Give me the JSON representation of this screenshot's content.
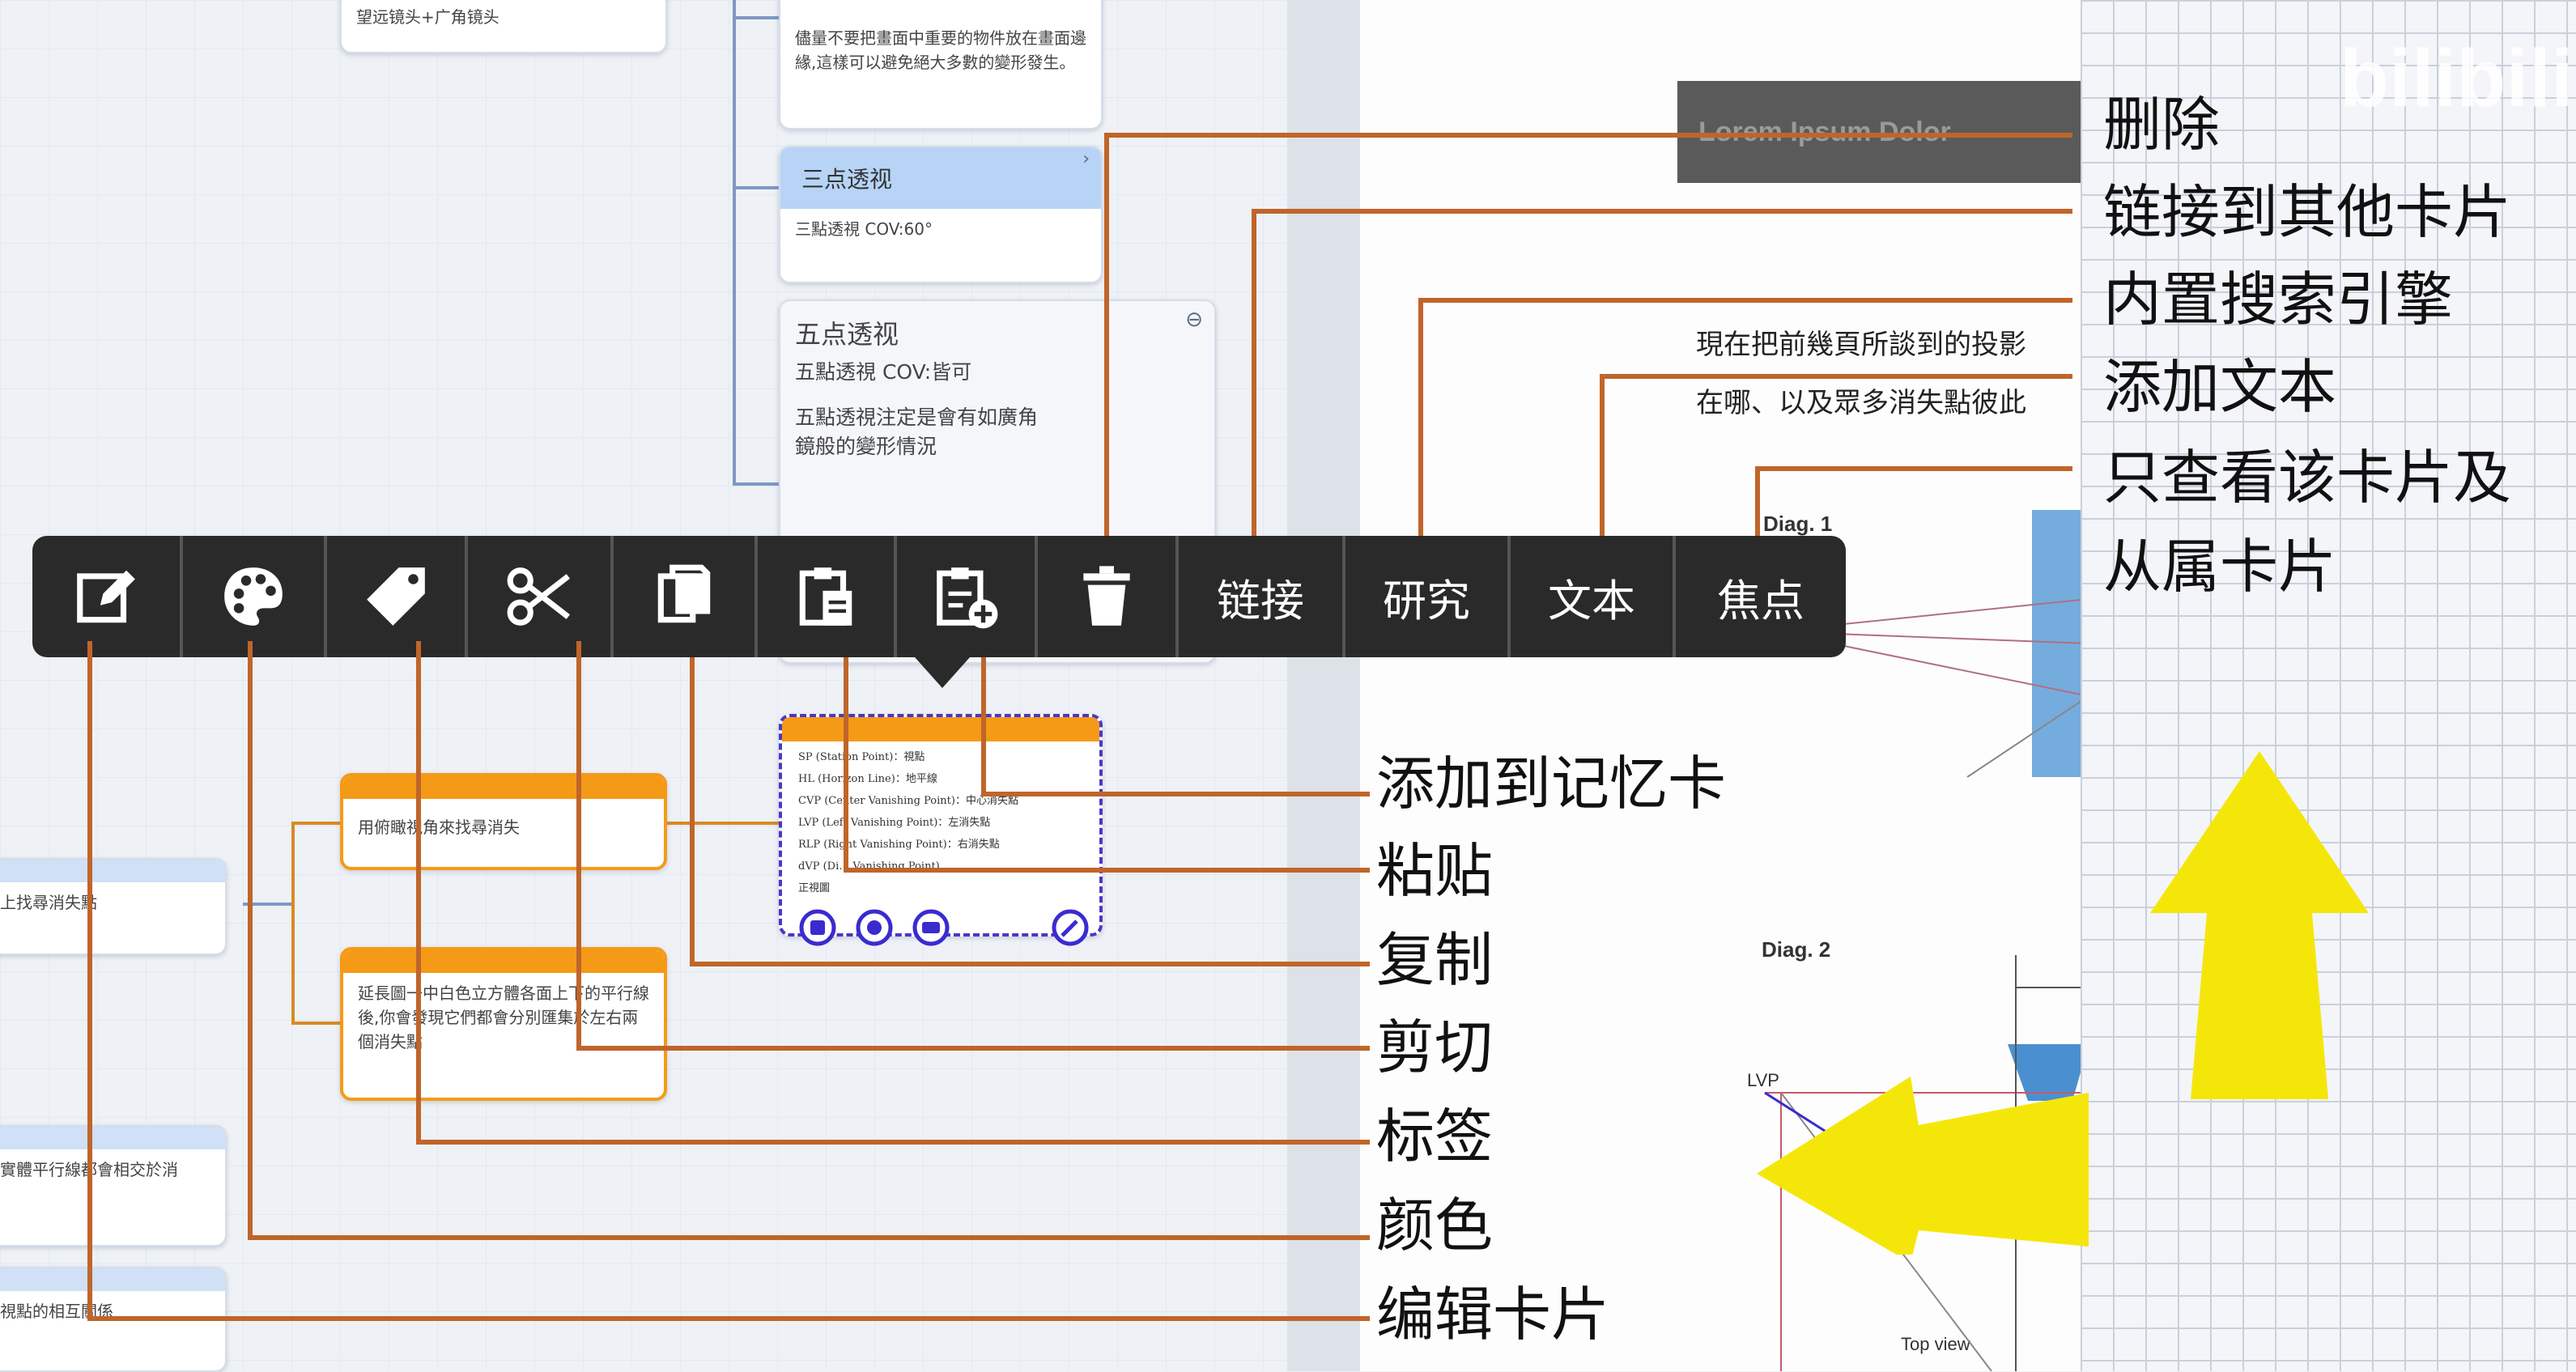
{
  "mindmap": {
    "top_card_text": "望远镜头+广角镜头",
    "note_card_text": "儘量不要把畫面中重要的物件放在畫面邊緣,這樣可以避免絕大多數的變形發生。",
    "three_point": {
      "title": "三点透视",
      "body": "三點透視 COV:60°"
    },
    "five_point": {
      "title": "五点透视",
      "line1": "五點透視 COV:皆可",
      "line2": "五點透視注定是會有如廣角鏡般的變形情況"
    },
    "orange_card_1": "用俯瞰視角來找尋消失",
    "orange_card_2": "延長圖一中白色立方體各面上下的平行線後,你會發現它們都會分別匯集於左右兩個消失點",
    "left_card_1": "上找尋消失點",
    "left_card_2": "實體平行線都會相交於消",
    "left_card_3": "視點的相互關係",
    "selected_card_lines": [
      "SP (Station Point)：視點",
      "HL (Horizon Line)：地平線",
      "CVP (Center Vanishing Point)：中心消失點",
      "LVP (Left Vanishing Point)：左消失點",
      "RLP (Right Vanishing Point)：右消失點",
      "dVP (Di… Vanishing Point)",
      "正視圖"
    ]
  },
  "toolbar": {
    "edit_icon": "edit-card-icon",
    "palette_icon": "palette-icon",
    "tag_icon": "tag-icon",
    "scissors_icon": "scissors-icon",
    "copy_icon": "copy-icon",
    "paste_icon": "paste-icon",
    "add_memory_icon": "add-to-flashcard-icon",
    "delete_icon": "trash-icon",
    "link_label": "链接",
    "research_label": "研究",
    "text_label": "文本",
    "focus_label": "焦点"
  },
  "document": {
    "header_bar": "Lorem Ipsum Dolor",
    "line1": "現在把前幾頁所談到的投影",
    "line2": "在哪、以及眾多消失點彼此",
    "diag1": "Diag. 1",
    "diag2": "Diag. 2",
    "lvp_label": "LVP",
    "top_view": "Top view"
  },
  "watermark": "bilibili",
  "annotations": {
    "delete": "删除",
    "link_other": "链接到其他卡片",
    "search_engine": "内置搜索引擎",
    "add_text": "添加文本",
    "focus_line1": "只查看该卡片及",
    "focus_line2": "从属卡片",
    "add_memory": "添加到记忆卡",
    "paste": "粘贴",
    "copy": "复制",
    "cut": "剪切",
    "tag": "标签",
    "color": "颜色",
    "edit": "编辑卡片"
  },
  "colors": {
    "annotation_line": "#c0652a",
    "toolbar_bg": "#2a2a2a",
    "card_orange": "#f59a16",
    "card_blue": "#b7d4f7",
    "selected_border": "#4a37c8",
    "arrow_yellow": "#f5e60a"
  }
}
